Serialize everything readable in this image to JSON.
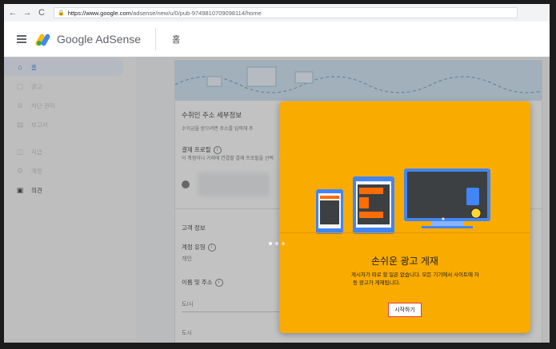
{
  "browser": {
    "back": "←",
    "forward": "→",
    "reload": "C",
    "url_host": "https://www.google.com",
    "url_path": "/adsense/new/u/0/pub-9749810709098114/home"
  },
  "header": {
    "brand": "Google AdSense",
    "page_title": "홈"
  },
  "sidebar": {
    "items": [
      {
        "label": "홈",
        "icon": "home-icon"
      },
      {
        "label": "광고",
        "icon": "ads-icon"
      },
      {
        "label": "차단 관리",
        "icon": "block-icon"
      },
      {
        "label": "보고서",
        "icon": "report-icon"
      },
      {
        "label": "지급",
        "icon": "payment-icon"
      },
      {
        "label": "계정",
        "icon": "settings-icon"
      },
      {
        "label": "의견",
        "icon": "feedback-icon"
      }
    ]
  },
  "main": {
    "section_title": "수취인 주소 세부정보",
    "section_sub": "수익금을 받으려면 주소를 입력해 주",
    "payment_profile": "결제 프로필",
    "payment_profile_sub": "이 계정이나 거래에 연결할 결제 프로필을 선택",
    "customer_info": "고객 정보",
    "account_type": "계정 유형",
    "account_type_value": "개인",
    "name_address": "이름 및 주소",
    "city_placeholder": "도/시",
    "city": "도시"
  },
  "modal": {
    "title": "손쉬운 광고 게재",
    "desc_line1": "게시자가 따로 할 일은 없습니다. 모든 기기에서 사이트에 자",
    "desc_line2": "동 광고가 게재됩니다.",
    "start_button": "시작하기",
    "page_count": 3,
    "active_page": 1
  },
  "colors": {
    "modal_bg": "#f9ab00",
    "active_nav": "#1a73e8",
    "highlight_border": "#e53935"
  }
}
